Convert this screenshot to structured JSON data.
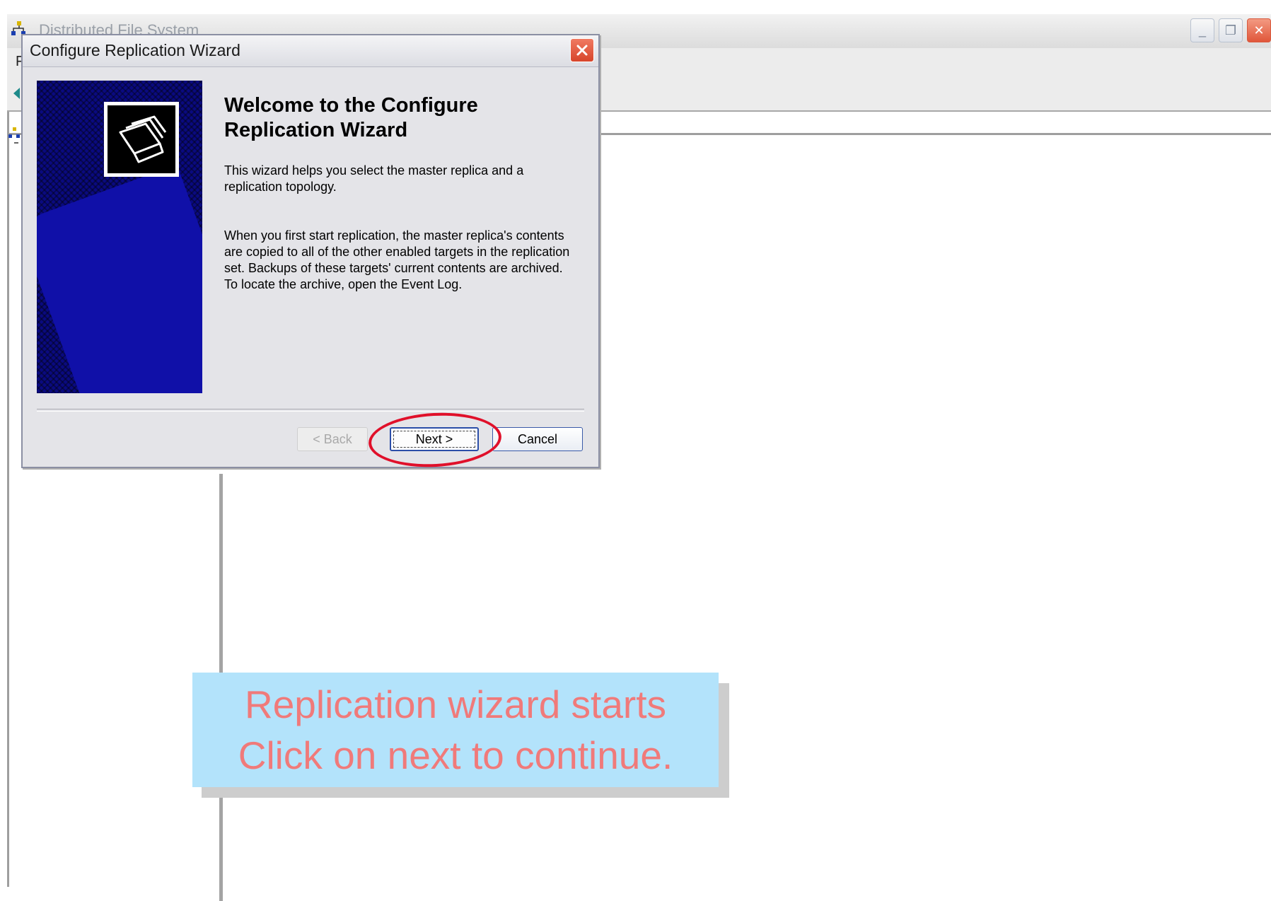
{
  "main_window": {
    "title": "Distributed File System",
    "controls": {
      "minimize": "_",
      "maximize": "❐",
      "close": "✕"
    },
    "menu_first_letter": "F"
  },
  "dialog": {
    "title": "Configure Replication Wizard",
    "heading": "Welcome to the Configure Replication Wizard",
    "intro": "This wizard helps you select the master replica and a replication topology.",
    "details": "When you first start replication, the master replica's contents are copied to all of the other enabled targets in the replication set. Backups of these targets' current contents are archived. To locate the archive, open the Event Log.",
    "buttons": {
      "back": "< Back",
      "next": "Next >",
      "cancel": "Cancel"
    },
    "close_glyph": "✕"
  },
  "callout": {
    "line1": "Replication wizard starts",
    "line2": "Click on next to continue."
  },
  "colors": {
    "highlight": "#e0102a",
    "callout_background": "#b3e3fb",
    "callout_text": "#f07a7a",
    "banner": "#0a0a80"
  },
  "icons": {
    "main_title": "dfs-icon",
    "banner": "folders-icon",
    "close": "close-icon"
  }
}
